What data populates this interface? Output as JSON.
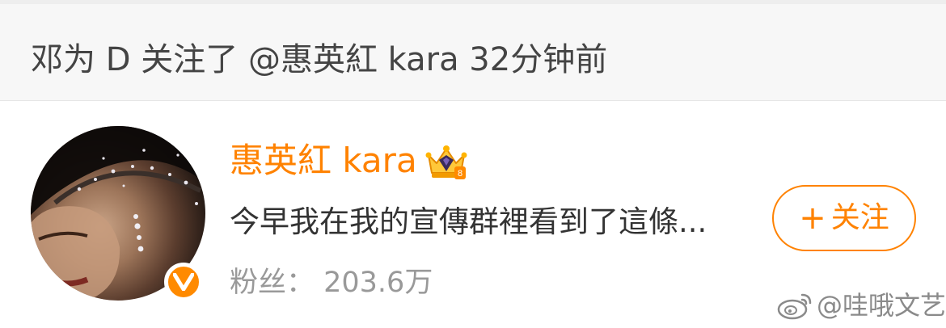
{
  "activity": {
    "text": "邓为 D 关注了 @惠英紅 kara 32分钟前"
  },
  "user": {
    "name": "惠英紅 kara",
    "bio": "今早我在我的宣傳群裡看到了這條...",
    "fans": "粉丝： 203.6万"
  },
  "follow_button": {
    "plus": "+",
    "label": "关注"
  },
  "watermark": {
    "text": "@哇哦文艺"
  },
  "icons": {
    "crown": "crown-badge-icon",
    "verified": "verified-v-icon",
    "weibo": "weibo-logo-icon"
  },
  "colors": {
    "accent": "#ff8200",
    "header_bg": "#f7f7f7",
    "text_primary": "#333333",
    "text_muted": "#999999"
  }
}
